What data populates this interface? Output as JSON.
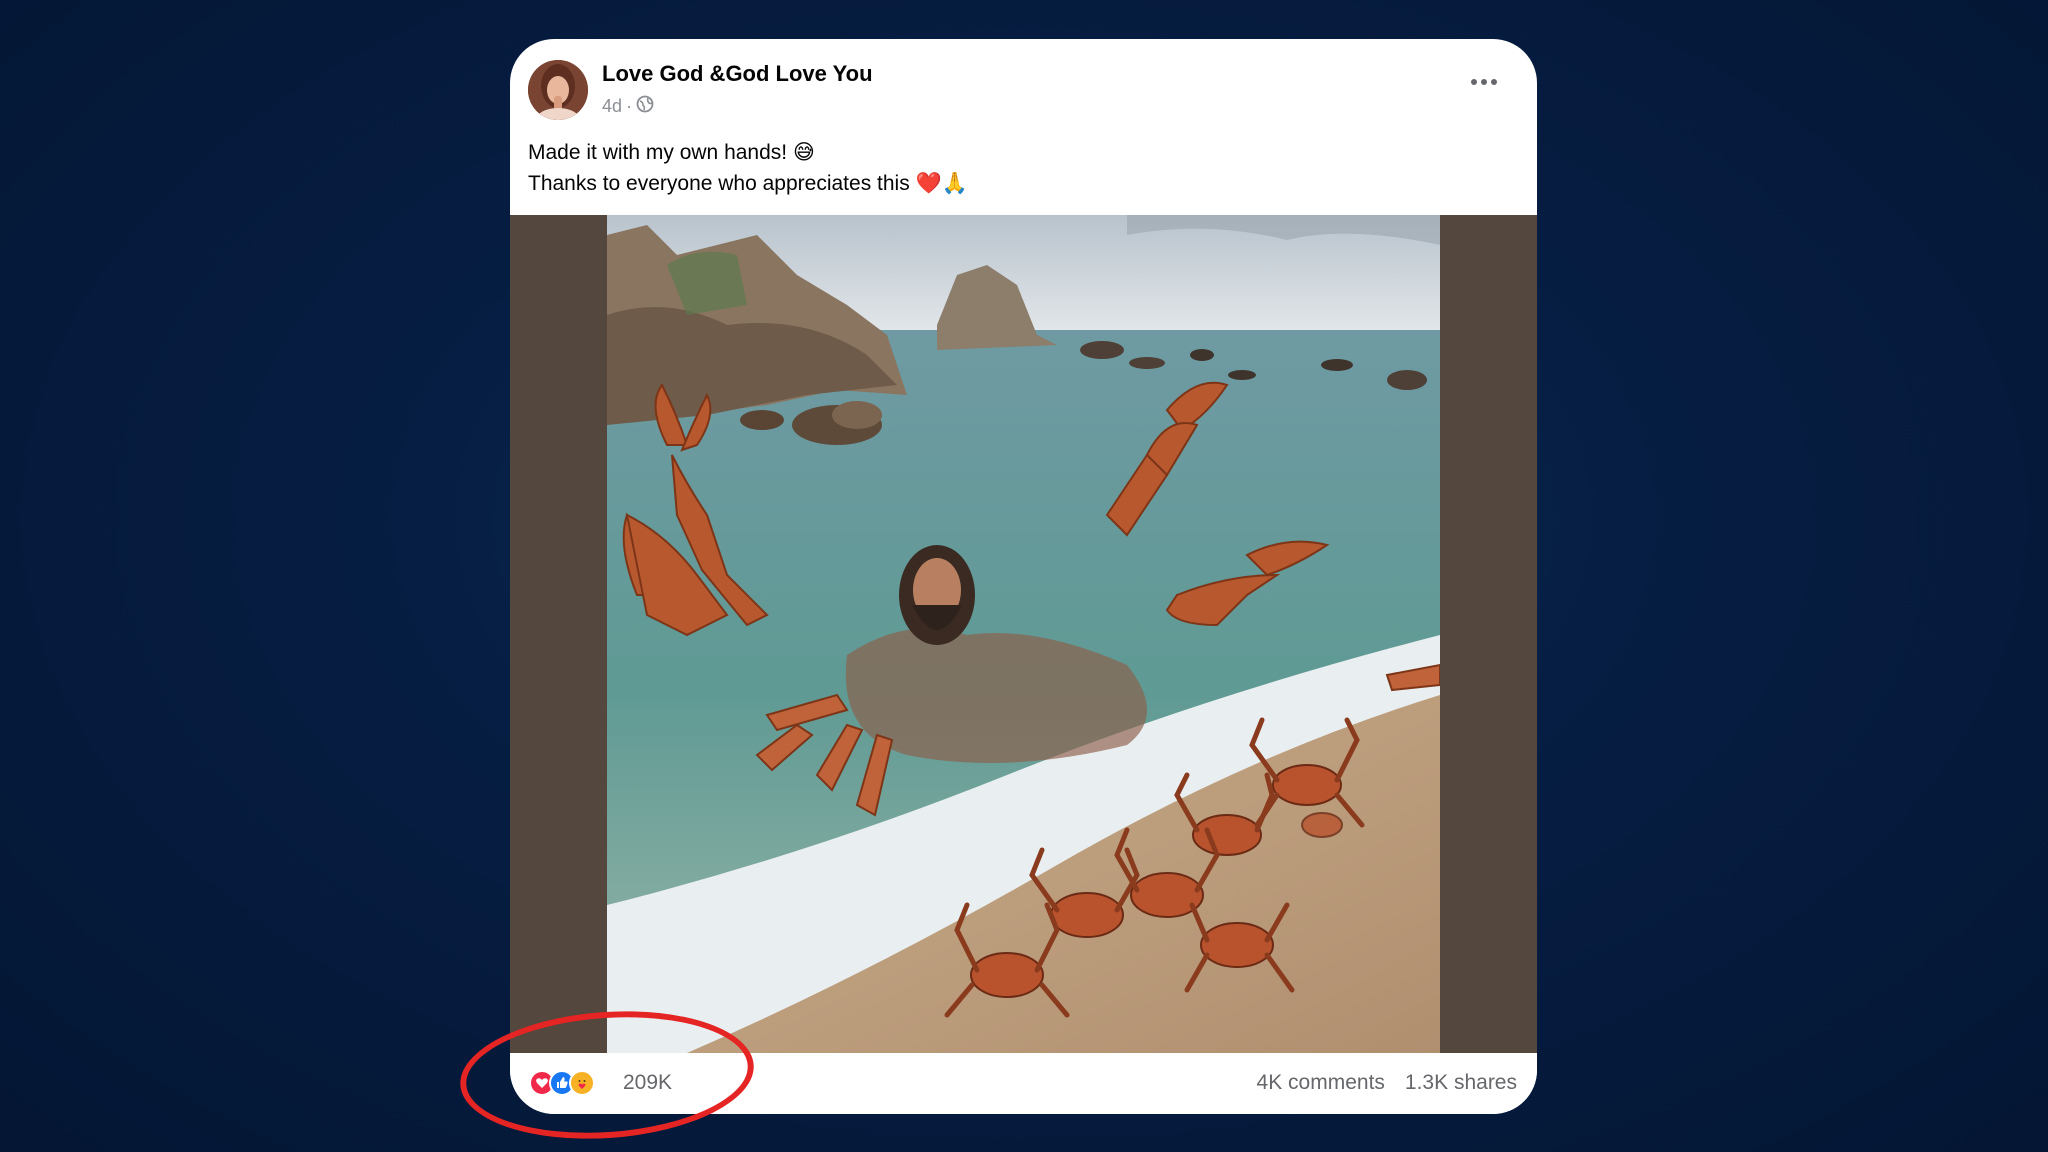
{
  "post": {
    "author": "Love God &God Love You",
    "time": "4d",
    "separator": "·",
    "privacy_icon": "globe-icon",
    "caption_line1": "Made it with my own hands! 😅",
    "caption_line2": "Thanks to everyone who appreciates this ❤️🙏",
    "more_icon": "more-options-icon"
  },
  "reactions": {
    "icons": [
      "love-reaction-icon",
      "like-reaction-icon",
      "care-reaction-icon"
    ],
    "count": "209K"
  },
  "stats": {
    "comments": "4K comments",
    "shares": "1.3K shares"
  },
  "colors": {
    "background": "#061d42",
    "highlight": "#e52424",
    "love": "#f0284a",
    "like": "#1877f2",
    "care": "#f7b125"
  }
}
